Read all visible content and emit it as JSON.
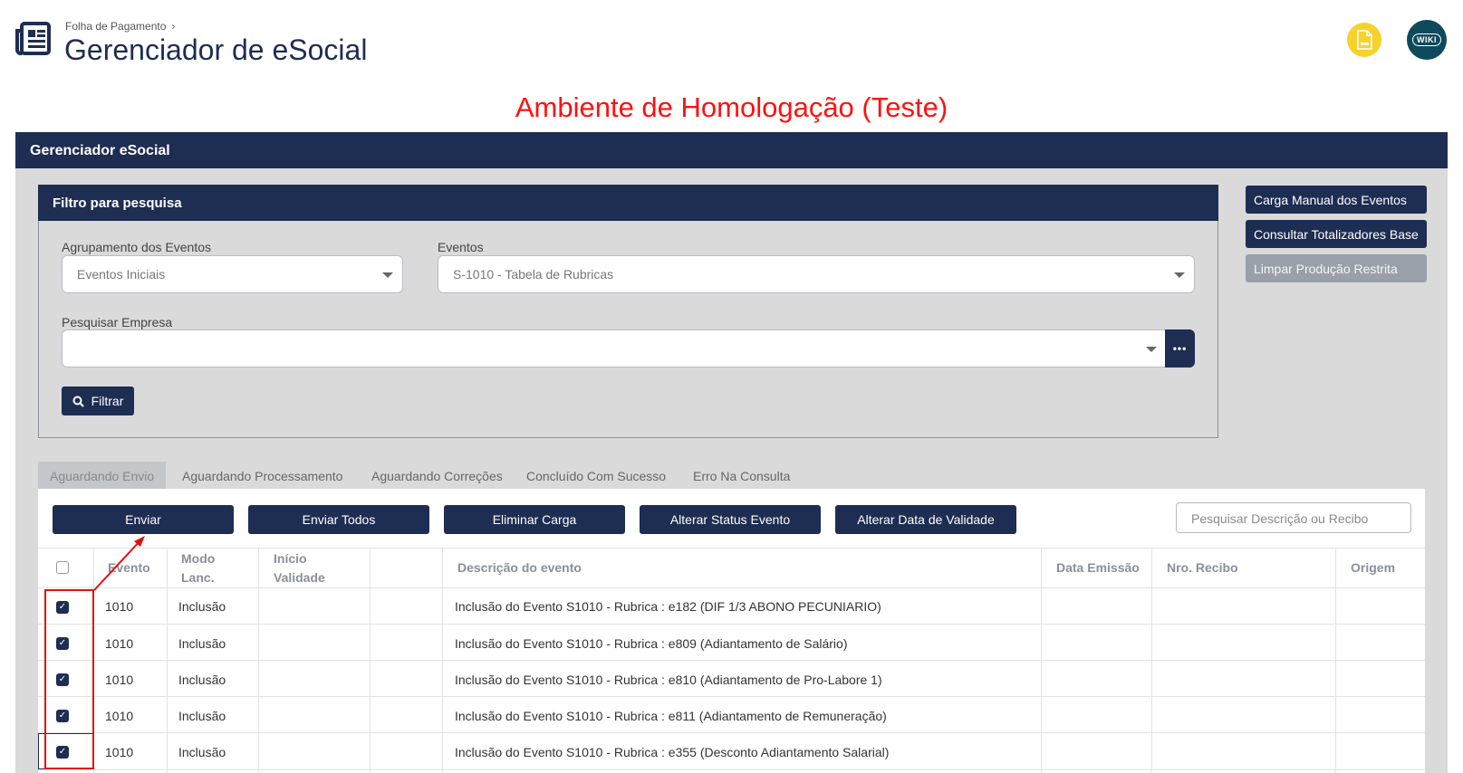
{
  "header": {
    "breadcrumb": "Folha de Pagamento",
    "title": "Gerenciador de eSocial",
    "pdf_icon": "pdf-file-icon",
    "wiki_label": "WIKI"
  },
  "environment_banner": "Ambiente de Homologação (Teste)",
  "panel_title": "Gerenciador eSocial",
  "filter": {
    "title": "Filtro para pesquisa",
    "group_label": "Agrupamento dos Eventos",
    "group_value": "Eventos Iniciais",
    "events_label": "Eventos",
    "events_value": "S-1010 - Tabela de Rubricas",
    "company_label": "Pesquisar Empresa",
    "company_value": "",
    "dots_label": "•••",
    "filter_button": "Filtrar"
  },
  "side_actions": {
    "manual_load": "Carga Manual dos Eventos",
    "totals": "Consultar Totalizadores Base",
    "clear_restricted": "Limpar Produção Restrita"
  },
  "tabs": [
    {
      "label": "Aguardando Envio"
    },
    {
      "label": "Aguardando Processamento"
    },
    {
      "label": "Aguardando Correções"
    },
    {
      "label": "Concluído Com Sucesso"
    },
    {
      "label": "Erro Na Consulta"
    }
  ],
  "actions": {
    "send": "Enviar",
    "send_all": "Enviar Todos",
    "delete_load": "Eliminar Carga",
    "change_status": "Alterar Status Evento",
    "change_validity": "Alterar Data de Validade"
  },
  "search": {
    "placeholder": "Pesquisar Descrição ou Recibo"
  },
  "table": {
    "headers": {
      "event": "Evento",
      "mode_1": "Modo",
      "mode_2": "Lanc.",
      "start_1": "Início",
      "start_2": "Validade",
      "description": "Descrição do evento",
      "emission": "Data Emissão",
      "receipt": "Nro. Recibo",
      "origin": "Origem"
    },
    "rows": [
      {
        "event": "1010",
        "mode": "Inclusão",
        "description": "Inclusão do Evento S1010 - Rubrica : e182 (DIF 1/3 ABONO PECUNIARIO)"
      },
      {
        "event": "1010",
        "mode": "Inclusão",
        "description": "Inclusão do Evento S1010 - Rubrica : e809 (Adiantamento de Salário)"
      },
      {
        "event": "1010",
        "mode": "Inclusão",
        "description": "Inclusão do Evento S1010 - Rubrica : e810 (Adiantamento de Pro-Labore 1)"
      },
      {
        "event": "1010",
        "mode": "Inclusão",
        "description": "Inclusão do Evento S1010 - Rubrica : e811 (Adiantamento de Remuneração)"
      },
      {
        "event": "1010",
        "mode": "Inclusão",
        "description": "Inclusão do Evento S1010 - Rubrica : e355 (Desconto Adiantamento Salarial)"
      }
    ]
  },
  "colors": {
    "navy": "#1e2d52",
    "annotation_red": "#e01010",
    "panel_gray": "#dadada"
  }
}
